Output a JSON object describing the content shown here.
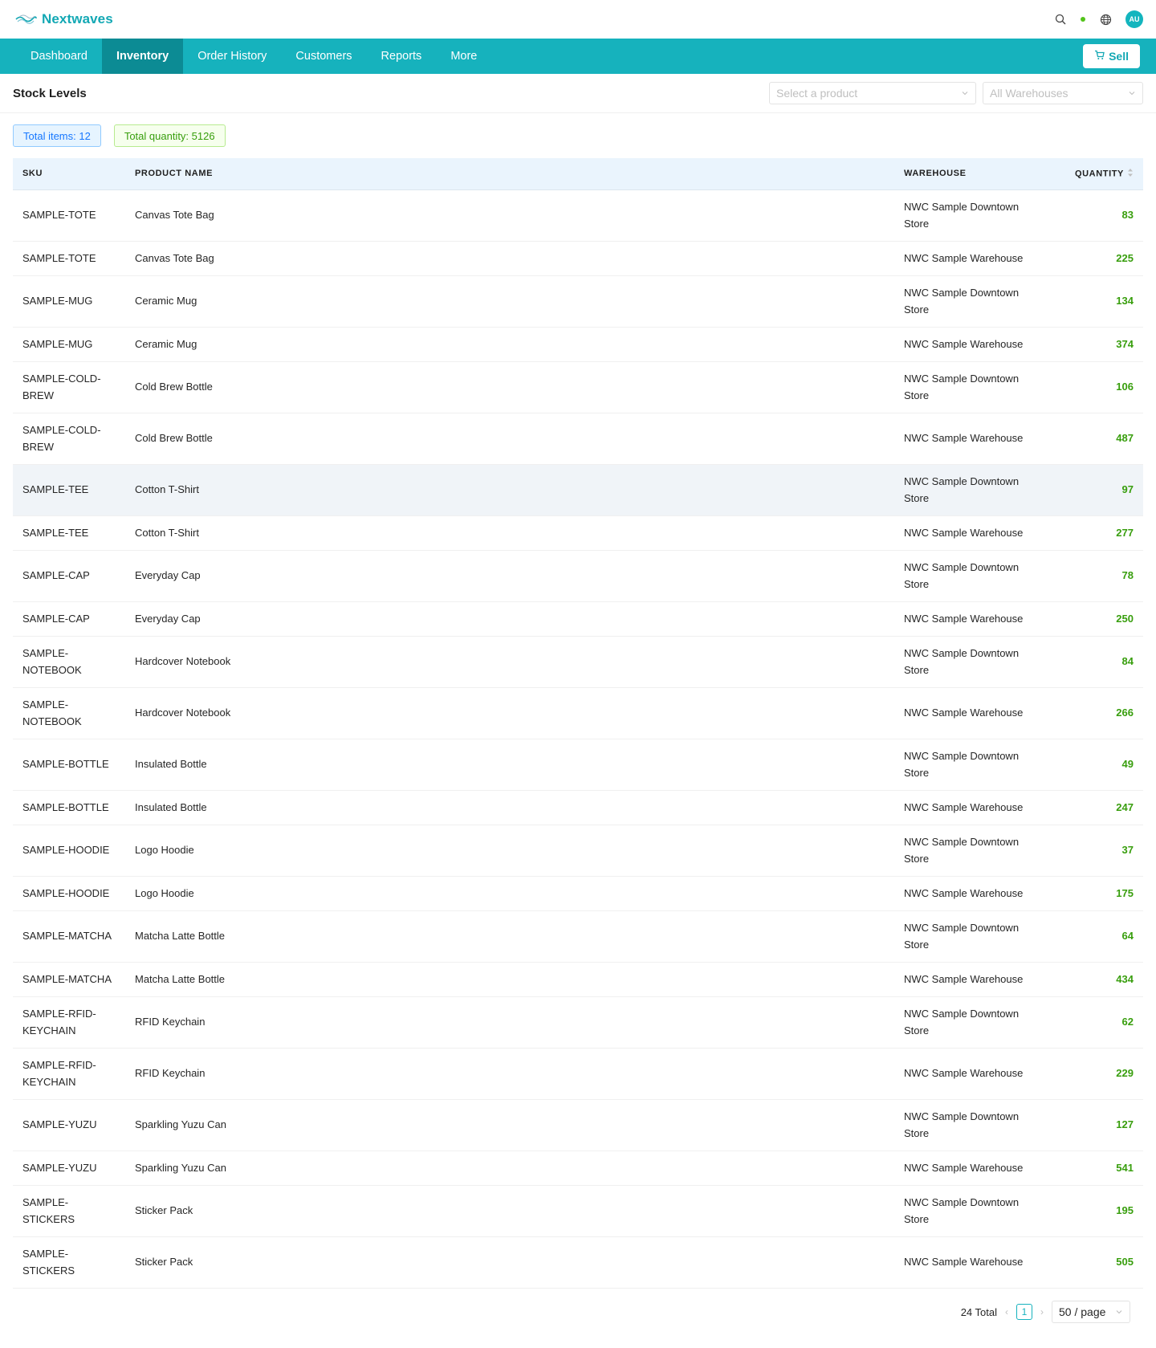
{
  "app": {
    "brand_name": "Nextwaves",
    "avatar_initials": "AU",
    "accent_color": "#16b2bd",
    "status_color": "#52c41a"
  },
  "nav": {
    "items": [
      {
        "label": "Dashboard"
      },
      {
        "label": "Inventory"
      },
      {
        "label": "Order History"
      },
      {
        "label": "Customers"
      },
      {
        "label": "Reports"
      },
      {
        "label": "More"
      }
    ],
    "active": "Inventory",
    "sell_label": "Sell"
  },
  "page": {
    "title": "Stock Levels",
    "product_placeholder": "Select a product",
    "warehouse_placeholder": "All Warehouses"
  },
  "stats": {
    "total_items": "Total items: 12",
    "total_quantity": "Total quantity: 5126"
  },
  "table": {
    "headers": {
      "sku": "SKU",
      "name": "PRODUCT NAME",
      "warehouse": "WAREHOUSE",
      "quantity": "QUANTITY"
    },
    "rows": [
      {
        "sku": "SAMPLE-TOTE",
        "name": "Canvas Tote Bag",
        "warehouse": "NWC Sample Downtown Store",
        "qty": "83"
      },
      {
        "sku": "SAMPLE-TOTE",
        "name": "Canvas Tote Bag",
        "warehouse": "NWC Sample Warehouse",
        "qty": "225"
      },
      {
        "sku": "SAMPLE-MUG",
        "name": "Ceramic Mug",
        "warehouse": "NWC Sample Downtown Store",
        "qty": "134"
      },
      {
        "sku": "SAMPLE-MUG",
        "name": "Ceramic Mug",
        "warehouse": "NWC Sample Warehouse",
        "qty": "374"
      },
      {
        "sku": "SAMPLE-COLD-BREW",
        "name": "Cold Brew Bottle",
        "warehouse": "NWC Sample Downtown Store",
        "qty": "106"
      },
      {
        "sku": "SAMPLE-COLD-BREW",
        "name": "Cold Brew Bottle",
        "warehouse": "NWC Sample Warehouse",
        "qty": "487"
      },
      {
        "sku": "SAMPLE-TEE",
        "name": "Cotton T-Shirt",
        "warehouse": "NWC Sample Downtown Store",
        "qty": "97"
      },
      {
        "sku": "SAMPLE-TEE",
        "name": "Cotton T-Shirt",
        "warehouse": "NWC Sample Warehouse",
        "qty": "277"
      },
      {
        "sku": "SAMPLE-CAP",
        "name": "Everyday Cap",
        "warehouse": "NWC Sample Downtown Store",
        "qty": "78"
      },
      {
        "sku": "SAMPLE-CAP",
        "name": "Everyday Cap",
        "warehouse": "NWC Sample Warehouse",
        "qty": "250"
      },
      {
        "sku": "SAMPLE-NOTEBOOK",
        "name": "Hardcover Notebook",
        "warehouse": "NWC Sample Downtown Store",
        "qty": "84"
      },
      {
        "sku": "SAMPLE-NOTEBOOK",
        "name": "Hardcover Notebook",
        "warehouse": "NWC Sample Warehouse",
        "qty": "266"
      },
      {
        "sku": "SAMPLE-BOTTLE",
        "name": "Insulated Bottle",
        "warehouse": "NWC Sample Downtown Store",
        "qty": "49"
      },
      {
        "sku": "SAMPLE-BOTTLE",
        "name": "Insulated Bottle",
        "warehouse": "NWC Sample Warehouse",
        "qty": "247"
      },
      {
        "sku": "SAMPLE-HOODIE",
        "name": "Logo Hoodie",
        "warehouse": "NWC Sample Downtown Store",
        "qty": "37"
      },
      {
        "sku": "SAMPLE-HOODIE",
        "name": "Logo Hoodie",
        "warehouse": "NWC Sample Warehouse",
        "qty": "175"
      },
      {
        "sku": "SAMPLE-MATCHA",
        "name": "Matcha Latte Bottle",
        "warehouse": "NWC Sample Downtown Store",
        "qty": "64"
      },
      {
        "sku": "SAMPLE-MATCHA",
        "name": "Matcha Latte Bottle",
        "warehouse": "NWC Sample Warehouse",
        "qty": "434"
      },
      {
        "sku": "SAMPLE-RFID-KEYCHAIN",
        "name": "RFID Keychain",
        "warehouse": "NWC Sample Downtown Store",
        "qty": "62"
      },
      {
        "sku": "SAMPLE-RFID-KEYCHAIN",
        "name": "RFID Keychain",
        "warehouse": "NWC Sample Warehouse",
        "qty": "229"
      },
      {
        "sku": "SAMPLE-YUZU",
        "name": "Sparkling Yuzu Can",
        "warehouse": "NWC Sample Downtown Store",
        "qty": "127"
      },
      {
        "sku": "SAMPLE-YUZU",
        "name": "Sparkling Yuzu Can",
        "warehouse": "NWC Sample Warehouse",
        "qty": "541"
      },
      {
        "sku": "SAMPLE-STICKERS",
        "name": "Sticker Pack",
        "warehouse": "NWC Sample Downtown Store",
        "qty": "195"
      },
      {
        "sku": "SAMPLE-STICKERS",
        "name": "Sticker Pack",
        "warehouse": "NWC Sample Warehouse",
        "qty": "505"
      }
    ]
  },
  "pagination": {
    "total": "24 Total",
    "current_page": "1",
    "page_size": "50 / page"
  }
}
